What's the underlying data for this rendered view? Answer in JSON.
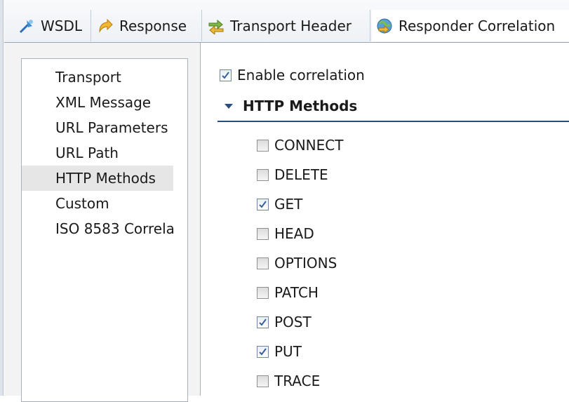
{
  "tabs": [
    {
      "label": "WSDL",
      "icon": "wsdl-icon"
    },
    {
      "label": "Response",
      "icon": "response-icon"
    },
    {
      "label": "Transport Header",
      "icon": "transport-header-icon"
    },
    {
      "label": "Responder Correlation",
      "icon": "responder-correlation-icon",
      "active": true
    }
  ],
  "nav": {
    "items": [
      "Transport",
      "XML Message",
      "URL Parameters",
      "URL Path",
      "HTTP Methods",
      "Custom",
      "ISO 8583 Correla"
    ],
    "selected": "HTTP Methods"
  },
  "panel": {
    "enable_label": "Enable correlation",
    "enable_checked": true,
    "section_title": "HTTP Methods",
    "methods": [
      {
        "label": "CONNECT",
        "checked": false
      },
      {
        "label": "DELETE",
        "checked": false
      },
      {
        "label": "GET",
        "checked": true
      },
      {
        "label": "HEAD",
        "checked": false
      },
      {
        "label": "OPTIONS",
        "checked": false
      },
      {
        "label": "PATCH",
        "checked": false
      },
      {
        "label": "POST",
        "checked": true
      },
      {
        "label": "PUT",
        "checked": true
      },
      {
        "label": "TRACE",
        "checked": false
      }
    ]
  },
  "colors": {
    "accent": "#2c4a78",
    "check": "#3b5f9a",
    "selected_bg": "#e6e6e6"
  }
}
